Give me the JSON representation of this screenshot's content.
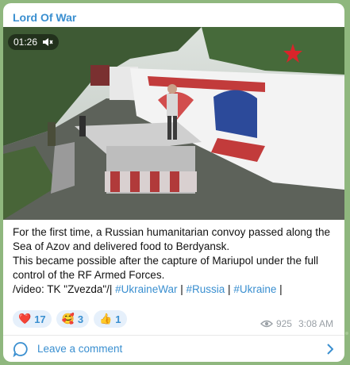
{
  "channel": {
    "name": "Lord Of War"
  },
  "video": {
    "duration": "01:26"
  },
  "message": {
    "line1": "For the first time, a Russian humanitarian convoy passed along the Sea of  Azov and delivered food to Berdyansk.",
    "line2": "This became possible after the capture of Mariupol under the full control of the RF Armed Forces.",
    "credit": "/video: TK \"Zvezda\"/|",
    "hashtags": [
      "#UkraineWar",
      "#Russia",
      "#Ukraine"
    ],
    "separator": "|"
  },
  "reactions": [
    {
      "emoji": "❤️",
      "count": "17"
    },
    {
      "emoji": "🥰",
      "count": "3"
    },
    {
      "emoji": "👍",
      "count": "1"
    }
  ],
  "meta": {
    "views": "925",
    "time": "3:08 AM"
  },
  "footer": {
    "comment_label": "Leave a comment"
  },
  "colors": {
    "accent": "#3a8fd0",
    "background": "#8fb77e"
  }
}
